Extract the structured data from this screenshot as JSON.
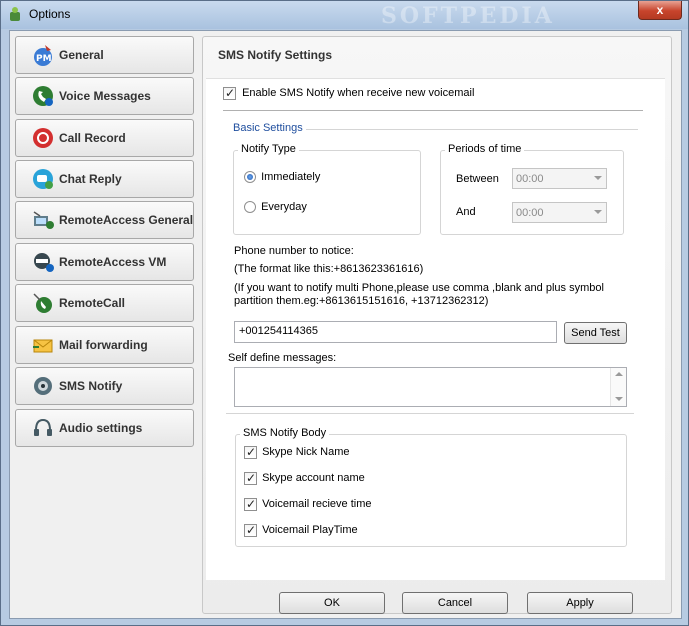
{
  "window": {
    "title": "Options",
    "watermark": "SOFTPEDIA",
    "close_label": "x"
  },
  "sidebar": {
    "items": [
      {
        "label": "General",
        "icon": "pm-icon"
      },
      {
        "label": "Voice Messages",
        "icon": "voice-messages-icon"
      },
      {
        "label": "Call Record",
        "icon": "record-icon"
      },
      {
        "label": "Chat Reply",
        "icon": "chat-icon"
      },
      {
        "label": "RemoteAccess General",
        "icon": "remote-access-icon"
      },
      {
        "label": "RemoteAccess VM",
        "icon": "remote-vm-icon"
      },
      {
        "label": "RemoteCall",
        "icon": "remote-call-icon"
      },
      {
        "label": "Mail forwarding",
        "icon": "mail-icon"
      },
      {
        "label": "SMS Notify",
        "icon": "sms-icon"
      },
      {
        "label": "Audio settings",
        "icon": "audio-icon"
      }
    ]
  },
  "panel": {
    "title": "SMS Notify Settings",
    "enable_label": "Enable SMS Notify when receive new voicemail",
    "basic_settings": "Basic Settings",
    "notify_type": {
      "label": "Notify Type",
      "immediately": "Immediately",
      "everyday": "Everyday"
    },
    "periods": {
      "label": "Periods of time",
      "between": "Between",
      "and": "And",
      "between_value": "00:00",
      "and_value": "00:00"
    },
    "phone": {
      "label": "Phone number to notice:",
      "format": "(The format like this:+8613623361616)",
      "hint_line1": "(If you want to notify multi Phone,please use comma ,blank and plus symbol",
      "hint_line2": "partition them.eg:+8613615151616, +13712362312)",
      "value": "+001254114365",
      "send_test": "Send Test"
    },
    "self_define_label": "Self define messages:",
    "body": {
      "label": "SMS Notify Body",
      "items": [
        "Skype Nick Name",
        "Skype account name",
        "Voicemail recieve time",
        "Voicemail PlayTime"
      ]
    }
  },
  "footer": {
    "ok": "OK",
    "cancel": "Cancel",
    "apply": "Apply"
  },
  "colors": {
    "accent": "#1d5bb8",
    "window_frame": "#b7cbe2",
    "close": "#c7442c"
  }
}
